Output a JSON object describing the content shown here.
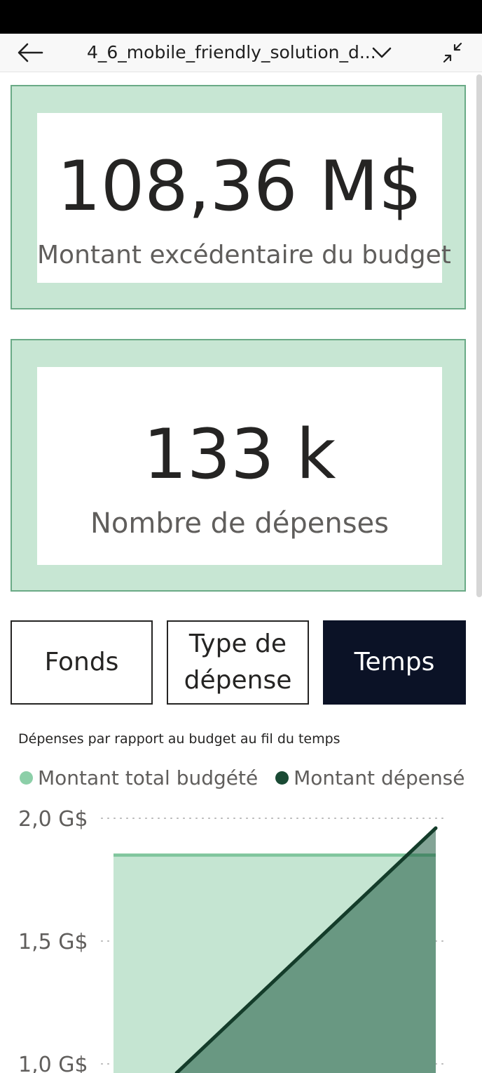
{
  "header": {
    "title": "4_6_mobile_friendly_solution_d...",
    "back_icon": "arrow-left-icon",
    "dropdown_icon": "chevron-down-icon",
    "collapse_icon": "collapse-arrows-icon"
  },
  "kpi_cards": [
    {
      "value": "108,36 M$",
      "label": "Montant excédentaire du budget"
    },
    {
      "value": "133 k",
      "label": "Nombre de dépenses"
    }
  ],
  "nav_buttons": [
    {
      "label": "Fonds",
      "active": false
    },
    {
      "label": "Type de dépense",
      "active": false
    },
    {
      "label": "Temps",
      "active": true
    }
  ],
  "colors": {
    "card_fill": "#c7e6d3",
    "card_border": "#6aaa86",
    "budget_series": "#8ccfa8",
    "spent_series": "#1a4a34",
    "active_button": "#0b1226"
  },
  "chart_data": {
    "type": "area",
    "title": "Dépenses par rapport au budget au fil du temps",
    "legend_position": "top-left",
    "series": [
      {
        "name": "Montant total budgété",
        "color": "#8ccfa8",
        "points": [
          [
            0,
            1.85
          ],
          [
            1,
            1.85
          ]
        ]
      },
      {
        "name": "Montant dépensé",
        "color": "#1a4a34",
        "points": [
          [
            0,
            0.72
          ],
          [
            1,
            1.96
          ]
        ]
      }
    ],
    "y_ticks": [
      "2,0 G$",
      "1,5 G$",
      "1,0 G$"
    ],
    "y_tick_values": [
      2.0,
      1.5,
      1.0
    ],
    "ylim": [
      0.95,
      2.05
    ],
    "grid": true
  }
}
